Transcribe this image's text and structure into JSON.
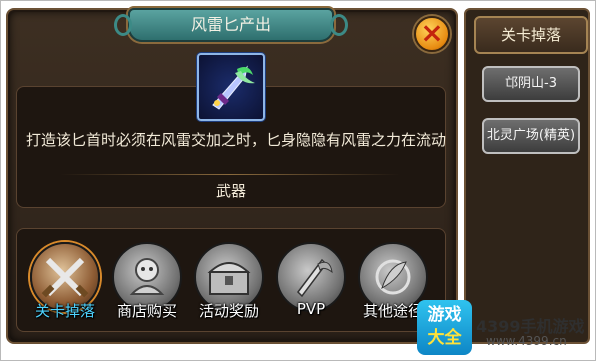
{
  "dialog": {
    "title": "风雷匕产出",
    "close_icon": "×",
    "description": "打造该匕首时必须在风雷交加之时，匕身隐隐有风雷之力在流动",
    "category": "武器"
  },
  "sources": [
    {
      "label": "关卡掉落",
      "icon": "crossed-swords-icon",
      "active": true
    },
    {
      "label": "商店购买",
      "icon": "shop-icon",
      "active": false
    },
    {
      "label": "活动奖励",
      "icon": "treasure-chest-icon",
      "active": false
    },
    {
      "label": "PVP",
      "icon": "pvp-blade-icon",
      "active": false
    },
    {
      "label": "其他途径",
      "icon": "feather-icon",
      "active": false
    }
  ],
  "side": {
    "tab": "关卡掉落",
    "items": [
      "邙阴山-3",
      "北灵广场(精英)"
    ]
  },
  "watermark": {
    "logo_line1": "游戏",
    "logo_line2": "大全",
    "brand": "4399手机游戏",
    "url": "www.4399.cn"
  },
  "colors": {
    "panel": "#2a2018",
    "title_tab": "#2e6f6e",
    "active_label": "#4fd4ff",
    "close_button": "#e78a10"
  }
}
